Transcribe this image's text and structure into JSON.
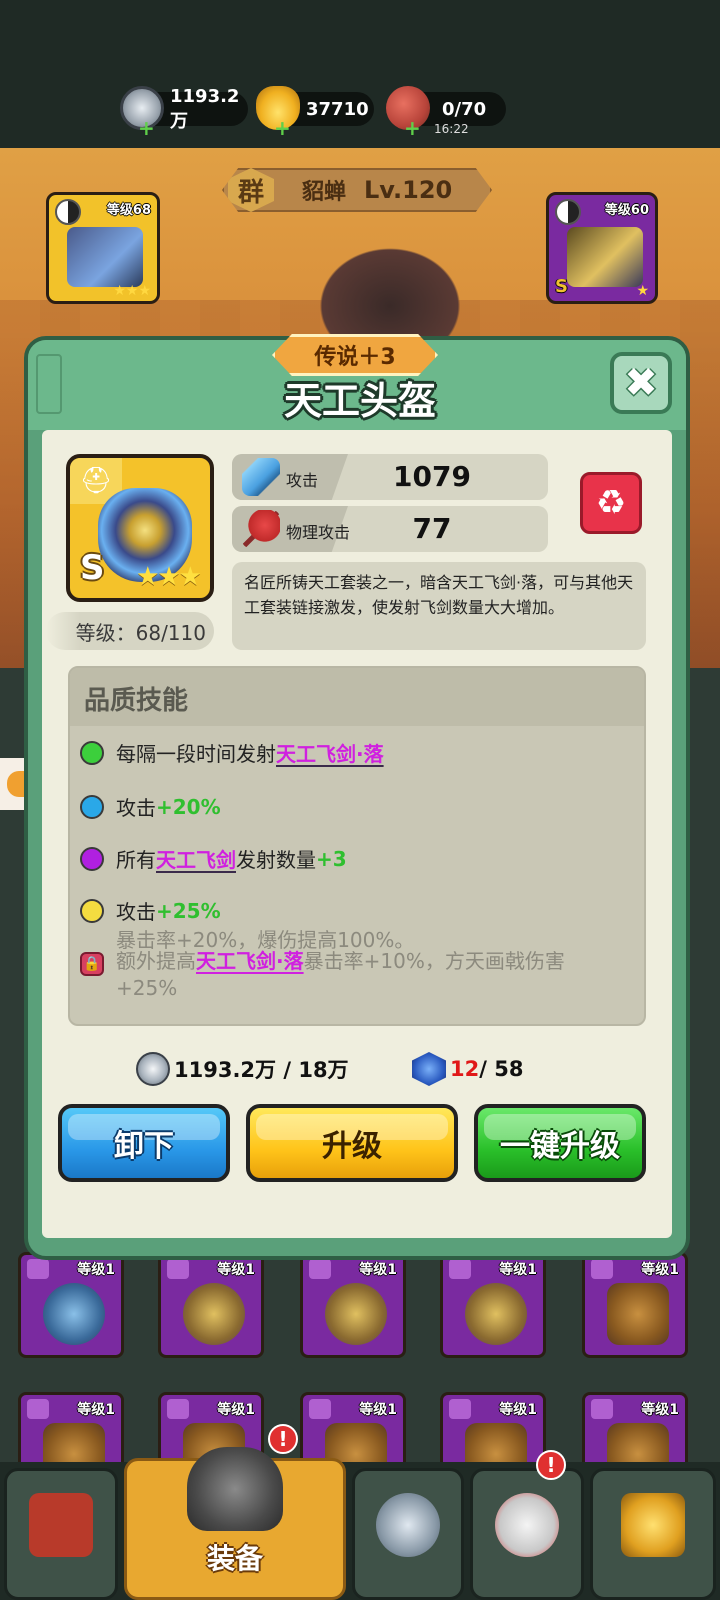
{
  "resources": {
    "silver": "1193.2万",
    "gold": "37710",
    "stamina": "0/70",
    "stamina_timer": "16:22",
    "plus": "+"
  },
  "hero": {
    "faction": "群",
    "name": "貂蝉",
    "level": "Lv.120"
  },
  "side_slots": {
    "left": {
      "level": "等级68",
      "grade": "S",
      "stars": "★★★"
    },
    "right": {
      "level": "等级60",
      "grade": "S",
      "stars": "★"
    }
  },
  "modal": {
    "quality": "传说＋3",
    "title": "天工头盔",
    "close_glyph": "✖",
    "item": {
      "grade": "S",
      "stars": "★★★",
      "level": "等级：68/110"
    },
    "stats": [
      {
        "label": "攻击",
        "value": "1079",
        "icon": "sword-icon"
      },
      {
        "label": "物理攻击",
        "value": "77",
        "icon": "axe-icon"
      }
    ],
    "recycle_glyph": "♻",
    "description": "名匠所铸天工套装之一，暗含天工飞剑·落，可与其他天工套装链接激发，使发射飞剑数量大大增加。",
    "skills_title": "品质技能",
    "skills": [
      {
        "color": "#3ccf3c",
        "prefix": "每隔一段时间发射",
        "highlight": "天工飞剑·落",
        "suffix": "",
        "bonus": ""
      },
      {
        "color": "#2aa8e8",
        "prefix": "攻击",
        "highlight": "",
        "suffix": "",
        "bonus": "+20%"
      },
      {
        "color": "#b020e0",
        "prefix": "所有",
        "highlight": "天工飞剑",
        "suffix": "发射数量",
        "bonus": "+3"
      },
      {
        "color": "#f4dc40",
        "prefix": "攻击",
        "highlight": "",
        "suffix": "",
        "bonus": "+25%"
      }
    ],
    "locked_line1": "暴击率+20%，爆伤提高100%。",
    "locked_prefix": "额外提高",
    "locked_highlight": "天工飞剑·落",
    "locked_suffix": "暴击率+10%，方天画戟伤害+25%",
    "cost_silver": "1193.2万 / 18万",
    "cost_material_have": "12",
    "cost_material_need": " / 58",
    "buttons": {
      "unequip": "卸下",
      "upgrade": "升级",
      "auto_upgrade": "一键升级"
    }
  },
  "grid_items": [
    {
      "level": "等级1"
    },
    {
      "level": "等级1"
    },
    {
      "level": "等级1"
    },
    {
      "level": "等级1"
    },
    {
      "level": "等级1"
    },
    {
      "level": "等级1"
    },
    {
      "level": "等级1"
    },
    {
      "level": "等级1"
    },
    {
      "level": "等级1"
    },
    {
      "level": "等级1"
    }
  ],
  "bottom_nav": {
    "active_label": "装备",
    "badge": "!"
  },
  "colors": {
    "modal_green": "#5aa07a",
    "legend_orange": "#f0a640",
    "highlight_purple": "#d020e0",
    "bonus_green": "#2fbf2f"
  }
}
